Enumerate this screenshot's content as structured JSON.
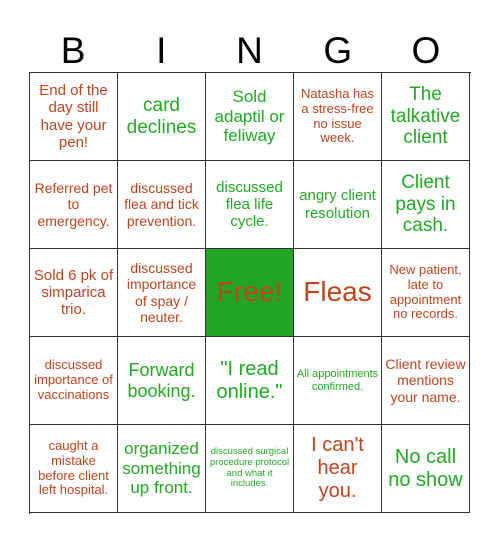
{
  "header": [
    "B",
    "I",
    "N",
    "G",
    "O"
  ],
  "cells": [
    {
      "text": "End of the day still have your pen!",
      "color": "red"
    },
    {
      "text": "card declines",
      "color": "green"
    },
    {
      "text": "Sold adaptil or feliway",
      "color": "green"
    },
    {
      "text": "Natasha has a stress-free no issue week.",
      "color": "red"
    },
    {
      "text": "The talkative client",
      "color": "green"
    },
    {
      "text": "Referred pet to emergency.",
      "color": "red"
    },
    {
      "text": "discussed flea and tick prevention.",
      "color": "red"
    },
    {
      "text": "discussed flea life cycle.",
      "color": "green"
    },
    {
      "text": "angry client resolution",
      "color": "green"
    },
    {
      "text": "Client pays in cash.",
      "color": "green"
    },
    {
      "text": "Sold 6 pk of simparica trio.",
      "color": "red"
    },
    {
      "text": "discussed importance of spay / neuter.",
      "color": "red"
    },
    {
      "text": "Free!",
      "color": "red",
      "free": true
    },
    {
      "text": "Fleas",
      "color": "red"
    },
    {
      "text": "New patient, late to appointment no records.",
      "color": "red"
    },
    {
      "text": "discussed importance of vaccinations",
      "color": "red"
    },
    {
      "text": "Forward booking.",
      "color": "green"
    },
    {
      "text": "\"I read online.\"",
      "color": "green"
    },
    {
      "text": "All appointments confirmed.",
      "color": "green"
    },
    {
      "text": "Client review mentions your name.",
      "color": "red"
    },
    {
      "text": "caught a mistake before client left hospital.",
      "color": "red"
    },
    {
      "text": "organized something up front.",
      "color": "green"
    },
    {
      "text": "discussed surgical procedure protocol and what it includes.",
      "color": "green"
    },
    {
      "text": "I can't hear you.",
      "color": "red"
    },
    {
      "text": "No call no show",
      "color": "green"
    }
  ],
  "colors": {
    "red": "#c0441e",
    "green": "#22aa22",
    "free_bg": "#22a522"
  }
}
